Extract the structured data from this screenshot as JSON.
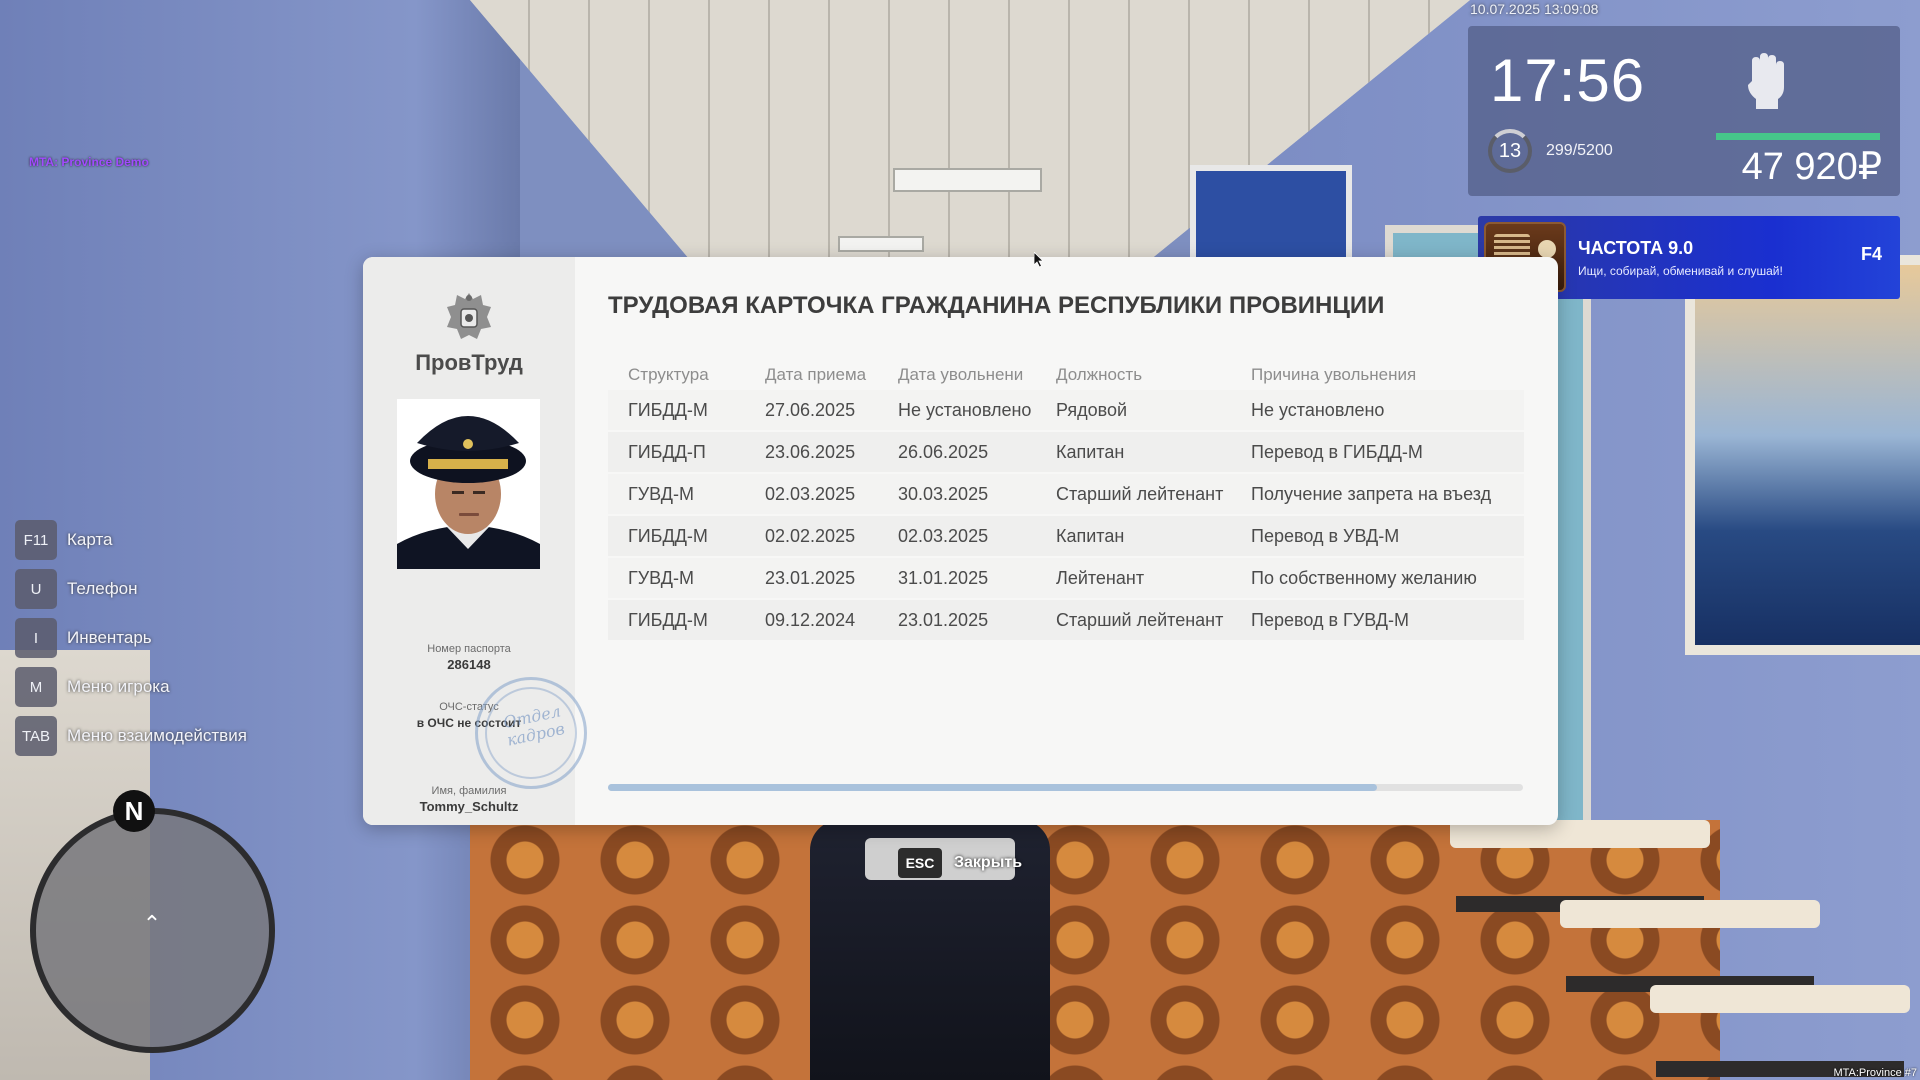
{
  "hud": {
    "datetime": "10.07.2025 13:09:08",
    "clock": "17:56",
    "level": "13",
    "xp": "299/5200",
    "money": "47 920₽",
    "server_name": "MTA: Province Demo",
    "build": "MTA:Province #7",
    "compass_north": "N",
    "hp_fraction": 1.0,
    "colors": {
      "hp": "#46c68a",
      "radio_bg": "#1a2fd0"
    }
  },
  "radio": {
    "title": "ЧАСТОТА 9.0",
    "subtitle": "Ищи, собирай, обменивай и слушай!",
    "key": "F4"
  },
  "keyhints": [
    {
      "key": "F11",
      "label": "Карта"
    },
    {
      "key": "U",
      "label": "Телефон"
    },
    {
      "key": "I",
      "label": "Инвентарь"
    },
    {
      "key": "M",
      "label": "Меню игрока"
    },
    {
      "key": "TAB",
      "label": "Меню взаимодействия"
    }
  ],
  "card": {
    "org_name": "ПровТруд",
    "title": "ТРУДОВАЯ КАРТОЧКА ГРАЖДАНИНА РЕСПУБЛИКИ ПРОВИНЦИИ",
    "name_label": "Имя, фамилия",
    "name_value": "Tommy_Schultz",
    "passport_label": "Номер паспорта",
    "passport_value": "286148",
    "ochs_label": "ОЧС-статус",
    "ochs_value": "в ОЧС не состоит",
    "stamp_text": [
      "Отдел",
      "кадров"
    ],
    "columns": [
      "Структура",
      "Дата приема",
      "Дата увольнени",
      "Должность",
      "Причина увольнения"
    ],
    "rows": [
      [
        "ГИБДД-М",
        "27.06.2025",
        "Не установлено",
        "Рядовой",
        "Не установлено"
      ],
      [
        "ГИБДД-П",
        "23.06.2025",
        "26.06.2025",
        "Капитан",
        "Перевод в ГИБДД-М"
      ],
      [
        "ГУВД-М",
        "02.03.2025",
        "30.03.2025",
        "Старший лейтенант",
        "Получение запрета на въезд"
      ],
      [
        "ГИБДД-М",
        "02.02.2025",
        "02.03.2025",
        "Капитан",
        "Перевод в УВД-М"
      ],
      [
        "ГУВД-М",
        "23.01.2025",
        "31.01.2025",
        "Лейтенант",
        "По собственному желанию"
      ],
      [
        "ГИБДД-М",
        "09.12.2024",
        "23.01.2025",
        "Старший лейтенант",
        "Перевод в ГУВД-М"
      ]
    ],
    "scroll_fraction": 0.84
  },
  "close": {
    "key": "ESC",
    "label": "Закрыть"
  },
  "icons": [
    "fist-icon",
    "radio-icon",
    "emblem-icon",
    "cursor-icon",
    "player-arrow-icon"
  ]
}
